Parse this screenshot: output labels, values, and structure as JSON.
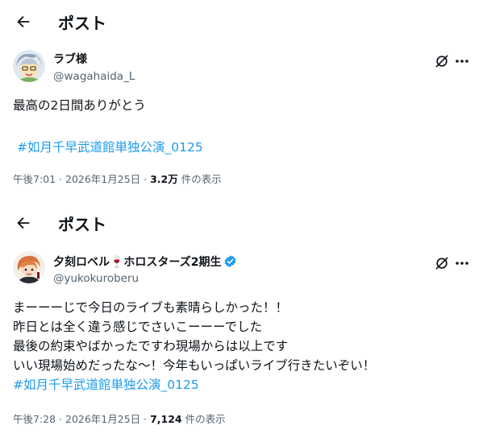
{
  "posts": [
    {
      "header_title": "ポスト",
      "display_name": "ラブ様",
      "handle": "@wagahaida_L",
      "text": "最高の2日間ありがとう",
      "hashtag": "#如月千早武道館単独公演_0125",
      "time": "午後7:01",
      "sep1": " · ",
      "date": "2026年1月25日",
      "sep2": " · ",
      "views": "3.2万",
      "views_suffix": " 件の表示"
    },
    {
      "header_title": "ポスト",
      "display_name": "夕刻ロベル🍷ホロスターズ2期生",
      "verified": true,
      "handle": "@yukokuroberu",
      "lines": [
        "まーーーじで今日のライブも素晴らしかった！！",
        "昨日とは全く違う感じでさいこーーーでした",
        "最後の約束やばかったですわ現場からは以上です",
        "いい現場始めだったな〜！今年もいっぱいライブ行きたいぞい！"
      ],
      "hashtag": "#如月千早武道館単独公演_0125",
      "time": "午後7:28",
      "sep1": " · ",
      "date": "2026年1月25日",
      "sep2": " · ",
      "views": "7,124",
      "views_suffix": " 件の表示"
    }
  ],
  "icons": [
    "back-arrow-icon",
    "grok-icon",
    "more-icon",
    "verified-badge-icon"
  ],
  "colors": {
    "accent": "#1d9bf0",
    "secondary_text": "#536471",
    "primary_text": "#0f1419"
  }
}
